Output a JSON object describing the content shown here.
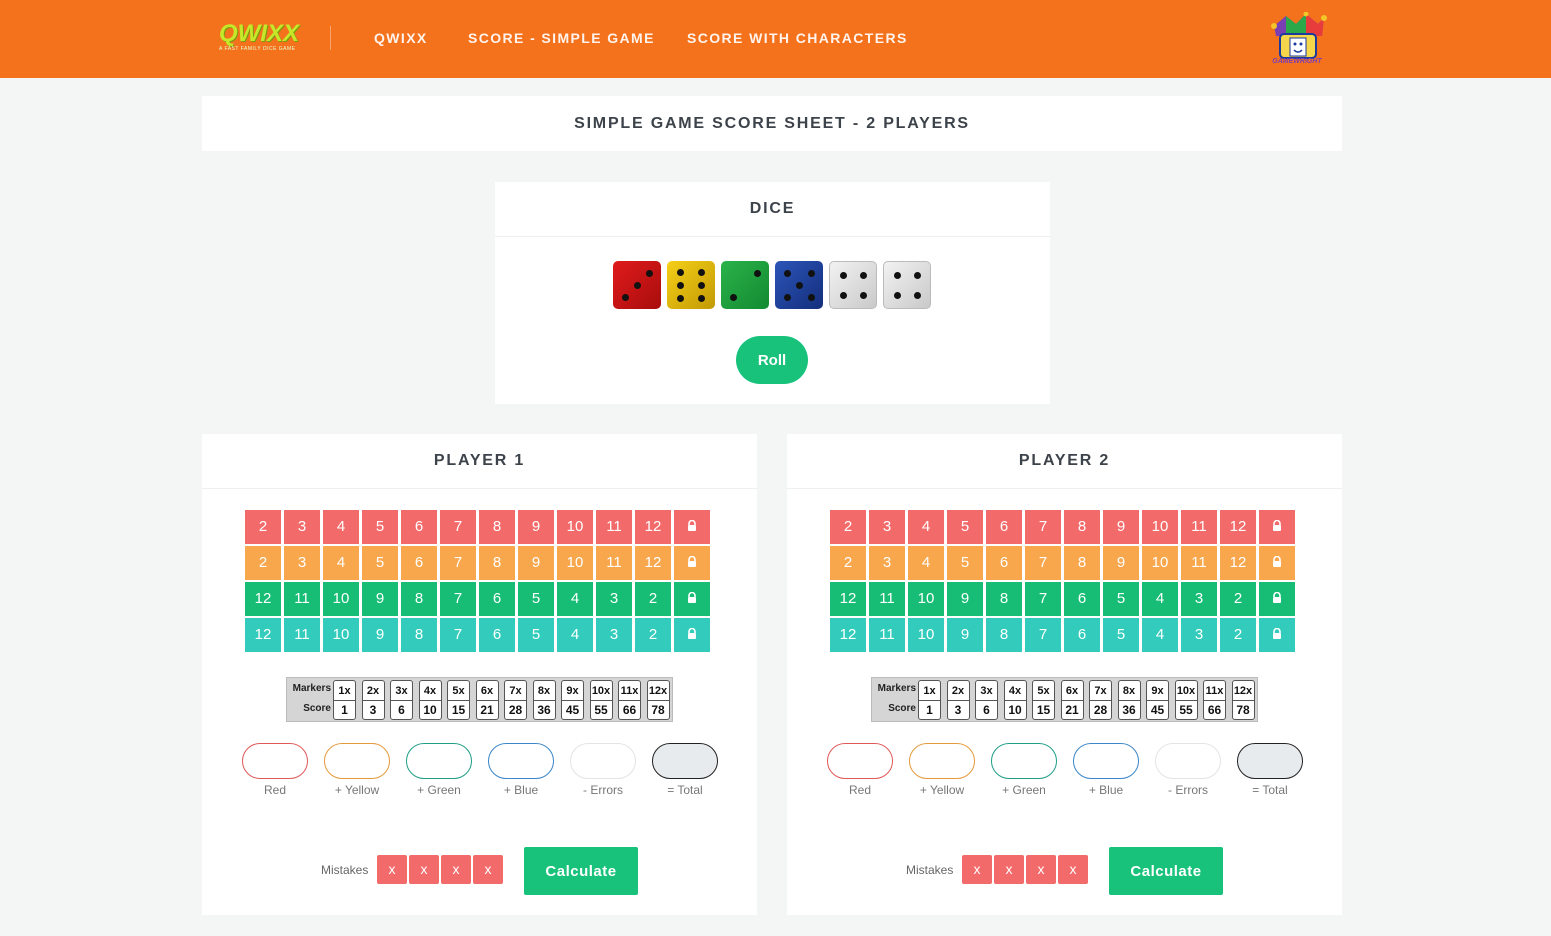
{
  "header": {
    "logo_text": "QWIXX",
    "logo_tagline": "A FAST FAMILY DICE GAME",
    "nav": [
      "QWIXX",
      "SCORE - SIMPLE GAME",
      "SCORE WITH CHARACTERS"
    ],
    "brand_logo_text": "GAMEWRIGHT",
    "accent_color": "#f5721c"
  },
  "page_title": "SIMPLE GAME SCORE SHEET - 2 PLAYERS",
  "dice": {
    "title": "DICE",
    "roll_label": "Roll",
    "values": [
      {
        "color": "red",
        "face": 3
      },
      {
        "color": "yellow",
        "face": 6
      },
      {
        "color": "green",
        "face": 2
      },
      {
        "color": "blue",
        "face": 5
      },
      {
        "color": "white",
        "face": 4
      },
      {
        "color": "white",
        "face": 4
      }
    ]
  },
  "score_table": {
    "markers_label": "Markers",
    "score_label": "Score",
    "markers": [
      "1x",
      "2x",
      "3x",
      "4x",
      "5x",
      "6x",
      "7x",
      "8x",
      "9x",
      "10x",
      "11x",
      "12x"
    ],
    "scores": [
      "1",
      "3",
      "6",
      "10",
      "15",
      "21",
      "28",
      "36",
      "45",
      "55",
      "66",
      "78"
    ]
  },
  "players": [
    {
      "title": "PLAYER 1",
      "rows": {
        "red": [
          "2",
          "3",
          "4",
          "5",
          "6",
          "7",
          "8",
          "9",
          "10",
          "11",
          "12"
        ],
        "yellow": [
          "2",
          "3",
          "4",
          "5",
          "6",
          "7",
          "8",
          "9",
          "10",
          "11",
          "12"
        ],
        "green": [
          "12",
          "11",
          "10",
          "9",
          "8",
          "7",
          "6",
          "5",
          "4",
          "3",
          "2"
        ],
        "blue": [
          "12",
          "11",
          "10",
          "9",
          "8",
          "7",
          "6",
          "5",
          "4",
          "3",
          "2"
        ]
      },
      "totals_labels": [
        "Red",
        "+ Yellow",
        "+ Green",
        "+ Blue",
        "- Errors",
        "= Total"
      ],
      "mistakes_label": "Mistakes",
      "mistakes": [
        "x",
        "x",
        "x",
        "x"
      ],
      "calculate_label": "Calculate"
    },
    {
      "title": "PLAYER 2",
      "rows": {
        "red": [
          "2",
          "3",
          "4",
          "5",
          "6",
          "7",
          "8",
          "9",
          "10",
          "11",
          "12"
        ],
        "yellow": [
          "2",
          "3",
          "4",
          "5",
          "6",
          "7",
          "8",
          "9",
          "10",
          "11",
          "12"
        ],
        "green": [
          "12",
          "11",
          "10",
          "9",
          "8",
          "7",
          "6",
          "5",
          "4",
          "3",
          "2"
        ],
        "blue": [
          "12",
          "11",
          "10",
          "9",
          "8",
          "7",
          "6",
          "5",
          "4",
          "3",
          "2"
        ]
      },
      "totals_labels": [
        "Red",
        "+ Yellow",
        "+ Green",
        "+ Blue",
        "- Errors",
        "= Total"
      ],
      "mistakes_label": "Mistakes",
      "mistakes": [
        "x",
        "x",
        "x",
        "x"
      ],
      "calculate_label": "Calculate"
    }
  ],
  "lock_icon": "lock-icon",
  "colors": {
    "red": "#f26a6a",
    "yellow": "#f8a74d",
    "green": "#17bd74",
    "blue": "#33ccbc",
    "button_green": "#18c27a"
  }
}
